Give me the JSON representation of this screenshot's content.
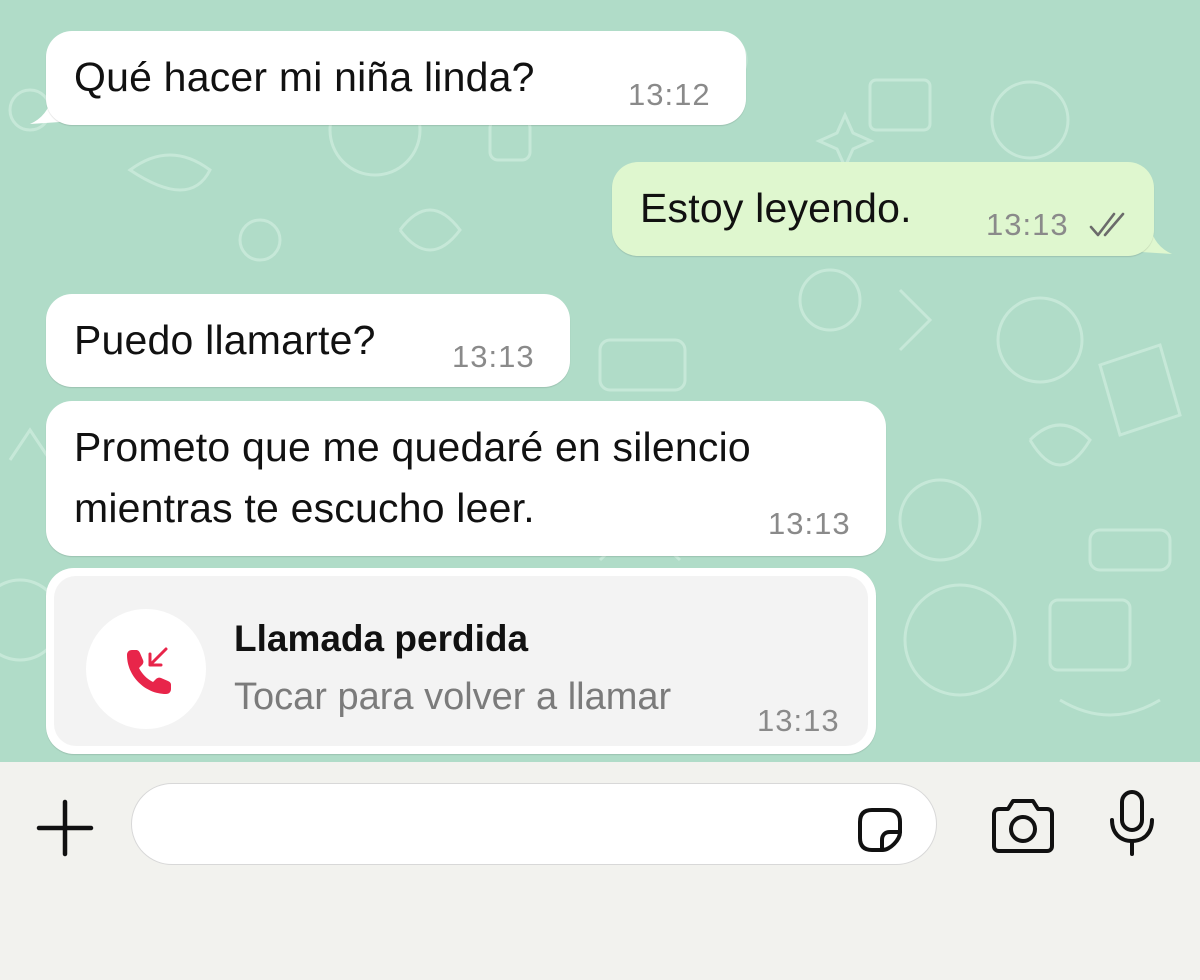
{
  "messages": [
    {
      "direction": "incoming",
      "text": "Qué hacer mi niña linda?",
      "time": "13:12"
    },
    {
      "direction": "outgoing",
      "text": "Estoy leyendo.",
      "time": "13:13",
      "status": "read"
    },
    {
      "direction": "incoming",
      "text": "Puedo llamarte?",
      "time": "13:13"
    },
    {
      "direction": "incoming",
      "text_line1": "Prometo que me quedaré en silencio",
      "text_line2": "mientras te escucho leer.",
      "time": "13:13"
    }
  ],
  "missed_call": {
    "title": "Llamada perdida",
    "subtitle": "Tocar para volver a llamar",
    "time": "13:13",
    "icon": "missed-call-icon",
    "icon_color": "#e8254a"
  },
  "input_bar": {
    "placeholder": "",
    "icons": [
      "plus-icon",
      "sticker-icon",
      "camera-icon",
      "microphone-icon"
    ]
  },
  "colors": {
    "chat_background": "#b0dcc8",
    "incoming_bubble": "#ffffff",
    "outgoing_bubble": "#dff7cf",
    "timestamp": "#8a8a8a"
  }
}
